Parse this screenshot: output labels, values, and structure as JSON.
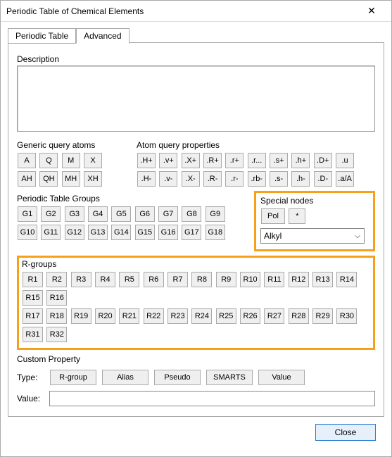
{
  "window": {
    "title": "Periodic Table of Chemical Elements"
  },
  "tabs": {
    "periodic": "Periodic Table",
    "advanced": "Advanced"
  },
  "description": {
    "label": "Description"
  },
  "gqa": {
    "label": "Generic query atoms",
    "row1": [
      "A",
      "Q",
      "M",
      "X"
    ],
    "row2": [
      "AH",
      "QH",
      "MH",
      "XH"
    ]
  },
  "aqp": {
    "label": "Atom query properties",
    "row1": [
      ".H+",
      ".v+",
      ".X+",
      ".R+",
      ".r+",
      ".r...",
      ".s+",
      ".h+",
      ".D+",
      ".u"
    ],
    "row2": [
      ".H-",
      ".v-",
      ".X-",
      ".R-",
      ".r-",
      ".rb-",
      ".s-",
      ".h-",
      ".D-",
      ".a/A"
    ]
  },
  "ptg": {
    "label": "Periodic Table Groups",
    "row1": [
      "G1",
      "G2",
      "G3",
      "G4",
      "G5",
      "G6",
      "G7",
      "G8",
      "G9"
    ],
    "row2": [
      "G10",
      "G11",
      "G12",
      "G13",
      "G14",
      "G15",
      "G16",
      "G17",
      "G18"
    ]
  },
  "special": {
    "label": "Special nodes",
    "buttons": [
      "Pol",
      "*"
    ],
    "dropdown_value": "Alkyl"
  },
  "rgroups": {
    "label": "R-groups",
    "row1": [
      "R1",
      "R2",
      "R3",
      "R4",
      "R5",
      "R6",
      "R7",
      "R8",
      "R9",
      "R10",
      "R11",
      "R12",
      "R13",
      "R14",
      "R15",
      "R16"
    ],
    "row2": [
      "R17",
      "R18",
      "R19",
      "R20",
      "R21",
      "R22",
      "R23",
      "R24",
      "R25",
      "R26",
      "R27",
      "R28",
      "R29",
      "R30",
      "R31",
      "R32"
    ]
  },
  "custom": {
    "label": "Custom Property",
    "type_label": "Type:",
    "types": [
      "R-group",
      "Alias",
      "Pseudo",
      "SMARTS",
      "Value"
    ],
    "value_label": "Value:",
    "value": ""
  },
  "footer": {
    "close": "Close"
  }
}
